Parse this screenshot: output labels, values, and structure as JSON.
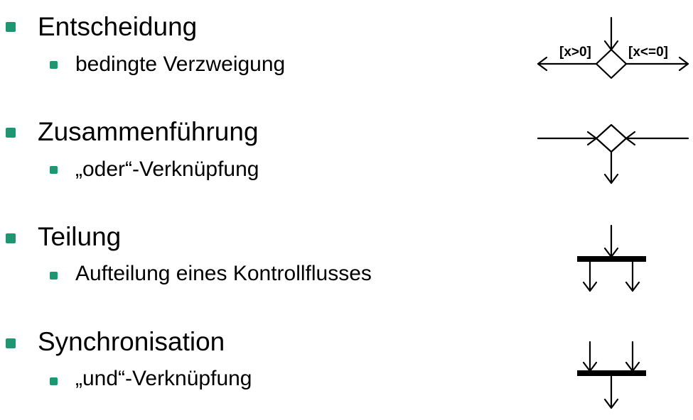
{
  "items": [
    {
      "title": "Entscheidung",
      "subtitle": "bedingte Verzweigung"
    },
    {
      "title": "Zusammenführung",
      "subtitle": "„oder“-Verknüpfung"
    },
    {
      "title": "Teilung",
      "subtitle": "Aufteilung eines Kontrollflusses"
    },
    {
      "title": "Synchronisation",
      "subtitle": "„und“-Verknüpfung"
    }
  ],
  "decision_labels": {
    "left": "[x>0]",
    "right": "[x<=0]"
  },
  "colors": {
    "bullet": "#1f9672",
    "stroke": "#000000"
  }
}
